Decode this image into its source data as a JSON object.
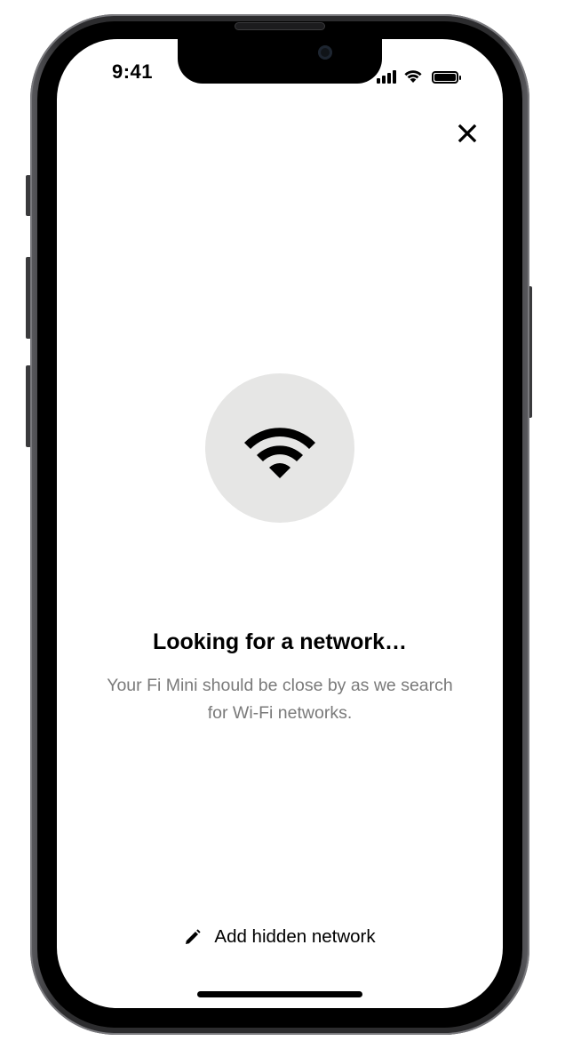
{
  "status_bar": {
    "time": "9:41",
    "signal_icon": "cellular-signal-icon",
    "wifi_icon": "wifi-status-icon",
    "battery_icon": "battery-icon"
  },
  "header": {
    "close_icon": "close-icon"
  },
  "main": {
    "illustration_icon": "wifi-icon",
    "title": "Looking for a network…",
    "subtitle": "Your Fi Mini should be close by as we search for Wi-Fi networks."
  },
  "footer": {
    "action_icon": "pencil-icon",
    "action_label": "Add hidden network"
  },
  "colors": {
    "background": "#ffffff",
    "illustration_bg": "#e6e6e5",
    "text_primary": "#000000",
    "text_secondary": "#7a7a7a"
  }
}
